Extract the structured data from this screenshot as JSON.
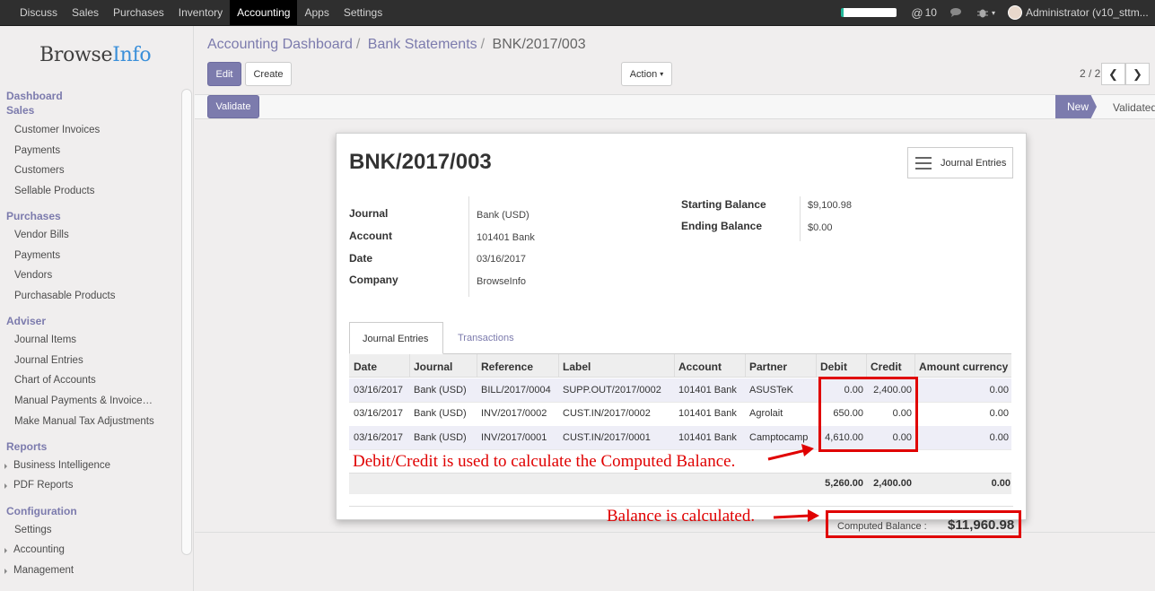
{
  "topbar": {
    "menu": [
      "Discuss",
      "Sales",
      "Purchases",
      "Inventory",
      "Accounting",
      "Apps",
      "Settings"
    ],
    "active_menu": "Accounting",
    "messages_count": "10",
    "user": "Administrator (v10_sttm..."
  },
  "sidebar": {
    "logo_main": "Browse",
    "logo_accent": "Info",
    "sections": [
      {
        "title": "Dashboard",
        "items": []
      },
      {
        "title": "Sales",
        "items": [
          "Customer Invoices",
          "Payments",
          "Customers",
          "Sellable Products"
        ]
      },
      {
        "title": "Purchases",
        "items": [
          "Vendor Bills",
          "Payments",
          "Vendors",
          "Purchasable Products"
        ]
      },
      {
        "title": "Adviser",
        "items": [
          "Journal Items",
          "Journal Entries",
          "Chart of Accounts",
          "Manual Payments & Invoice Matching",
          "Make Manual Tax Adjustments"
        ]
      },
      {
        "title": "Reports",
        "items": [
          "Business Intelligence",
          "PDF Reports"
        ]
      },
      {
        "title": "Configuration",
        "items": [
          "Settings",
          "Accounting",
          "Management"
        ]
      }
    ]
  },
  "breadcrumb": [
    "Accounting Dashboard",
    "Bank Statements",
    "BNK/2017/003"
  ],
  "buttons": {
    "edit": "Edit",
    "create": "Create",
    "action": "Action",
    "validate": "Validate"
  },
  "pager": "2 / 2",
  "status": {
    "new": "New",
    "validated": "Validated"
  },
  "record": {
    "name": "BNK/2017/003",
    "smart_button": "Journal Entries",
    "journal_label": "Journal",
    "journal": "Bank (USD)",
    "account_label": "Account",
    "account": "101401 Bank",
    "date_label": "Date",
    "date": "03/16/2017",
    "company_label": "Company",
    "company": "BrowseInfo",
    "starting_balance_label": "Starting Balance",
    "starting_balance": "$9,100.98",
    "ending_balance_label": "Ending Balance",
    "ending_balance": "$0.00"
  },
  "tabs": [
    "Journal Entries",
    "Transactions"
  ],
  "table": {
    "columns": [
      "Date",
      "Journal",
      "Reference",
      "Label",
      "Account",
      "Partner",
      "Debit",
      "Credit",
      "Amount currency"
    ],
    "rows": [
      [
        "03/16/2017",
        "Bank (USD)",
        "BILL/2017/0004",
        "SUPP.OUT/2017/0002",
        "101401 Bank",
        "ASUSTeK",
        "0.00",
        "2,400.00",
        "0.00"
      ],
      [
        "03/16/2017",
        "Bank (USD)",
        "INV/2017/0002",
        "CUST.IN/2017/0002",
        "101401 Bank",
        "Agrolait",
        "650.00",
        "0.00",
        "0.00"
      ],
      [
        "03/16/2017",
        "Bank (USD)",
        "INV/2017/0001",
        "CUST.IN/2017/0001",
        "101401 Bank",
        "Camptocamp",
        "4,610.00",
        "0.00",
        "0.00"
      ]
    ],
    "totals": {
      "debit": "5,260.00",
      "credit": "2,400.00",
      "amount_currency": "0.00"
    }
  },
  "computed": {
    "label": "Computed Balance :",
    "value": "$11,960.98"
  },
  "annotations": {
    "debit_credit": "Debit/Credit is used to calculate the Computed Balance.",
    "balance": "Balance is calculated.",
    "color": "#e00000"
  }
}
